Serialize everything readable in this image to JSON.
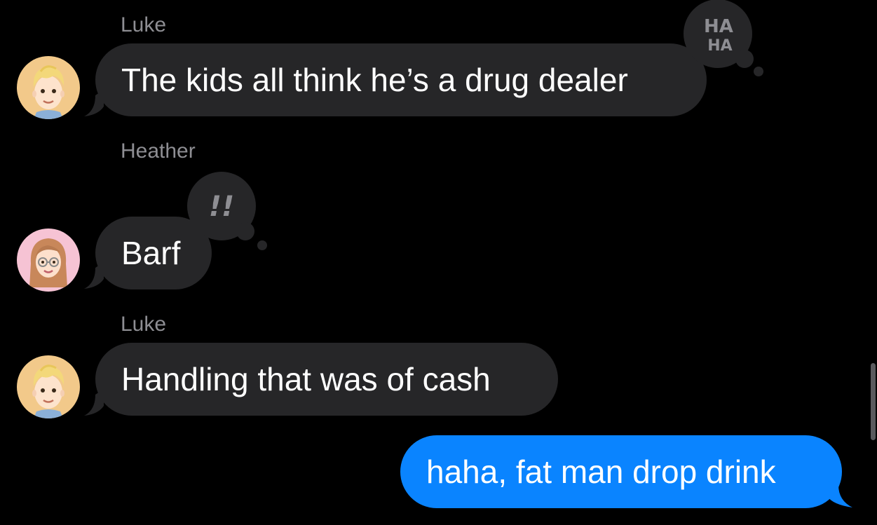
{
  "colors": {
    "background": "#000000",
    "incoming_bubble": "#262628",
    "outgoing_bubble": "#0a84ff",
    "sender_name": "#8e8e93",
    "message_text": "#ffffff",
    "tapback_bg": "#262628",
    "tapback_glyph": "#8e8e93"
  },
  "messages": [
    {
      "sender": "Luke",
      "text": "The kids all think he’s a drug dealer",
      "direction": "incoming",
      "avatar": "luke-memoji-avatar",
      "tapback": {
        "type": "haha",
        "label": "HA HA",
        "line1": "HA",
        "line2": "HA"
      }
    },
    {
      "sender": "Heather",
      "text": "Barf",
      "direction": "incoming",
      "avatar": "heather-memoji-avatar",
      "tapback": {
        "type": "emphasize",
        "label": "!!"
      }
    },
    {
      "sender": "Luke",
      "text": "Handling that was of cash",
      "direction": "incoming",
      "avatar": "luke-memoji-avatar"
    },
    {
      "text": "haha, fat man drop drink",
      "direction": "outgoing"
    }
  ]
}
